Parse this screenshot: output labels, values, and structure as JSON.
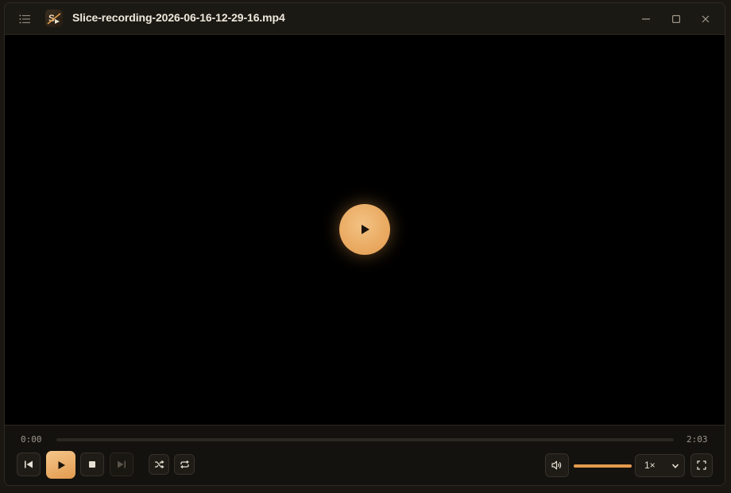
{
  "window": {
    "title": "Slice-recording-2026-06-16-12-29-16.mp4",
    "logo_letter": "S"
  },
  "icons": {
    "menu": "list-menu-icon",
    "minimize": "minimize-icon",
    "maximize": "maximize-icon",
    "close": "close-icon",
    "big_play": "play-icon",
    "previous": "skip-previous-icon",
    "play": "play-icon",
    "stop": "stop-icon",
    "next": "skip-next-icon",
    "shuffle": "shuffle-icon",
    "repeat": "repeat-icon",
    "volume": "volume-icon",
    "fullscreen": "fullscreen-icon"
  },
  "playback": {
    "current_time": "0:00",
    "duration": "2:03",
    "progress_fraction": 0.0,
    "volume_fraction": 1.0,
    "speed": "1×"
  },
  "colors": {
    "accent": "#e39a4c",
    "accent_light": "#f3c283",
    "background": "#14120f",
    "video": "#000000",
    "text": "#efe8dc",
    "muted_text": "#9d968a"
  }
}
